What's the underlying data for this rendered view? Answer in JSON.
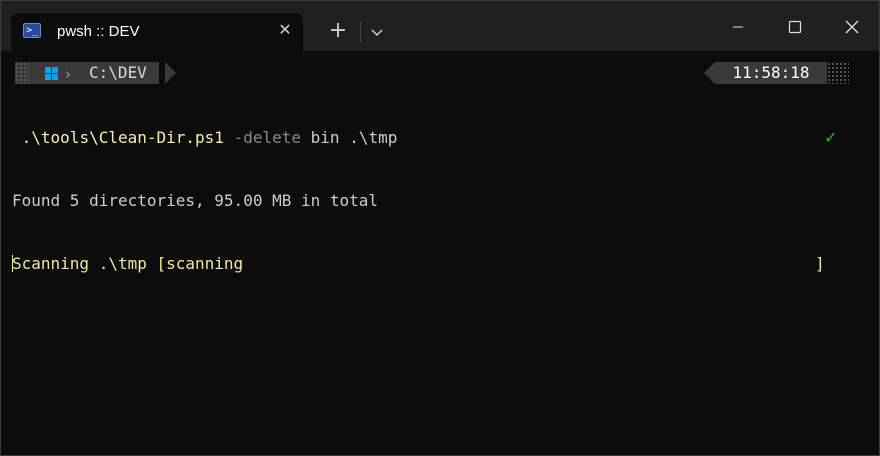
{
  "window": {
    "tab_title": "pwsh :: DEV",
    "tab_icon_glyph": ">_",
    "new_tab_glyph": "+",
    "tab_close_glyph": "✕"
  },
  "prompt": {
    "os_icon": "windows-icon",
    "path": "C:\\DEV",
    "time": "11:58:18",
    "status_glyph": "✓"
  },
  "command": {
    "script": ".\\tools\\Clean-Dir.ps1",
    "param": "-delete",
    "args": "bin .\\tmp"
  },
  "output": {
    "line1": "Found 5 directories, 95.00 MB in total",
    "line2": "Scanning .\\tmp [scanning",
    "line2_end": "]"
  },
  "colors": {
    "background": "#0c0c0c",
    "titlebar": "#202020",
    "segment": "#3a3a3a",
    "command": "#f9f1a5",
    "success": "#16c60c"
  }
}
